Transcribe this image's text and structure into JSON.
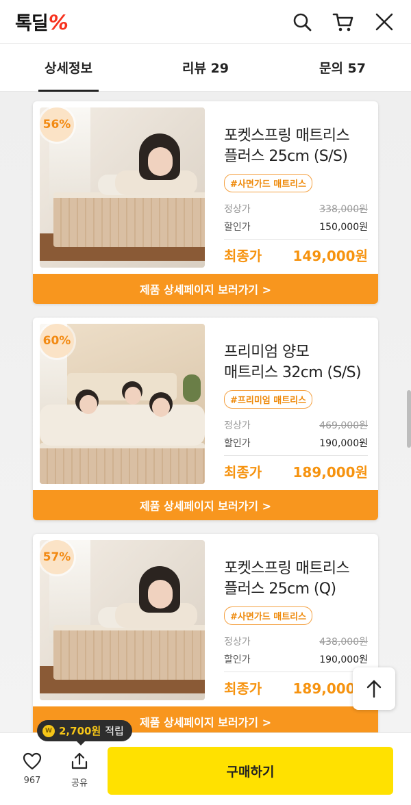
{
  "header": {
    "logo_text": "톡딜",
    "logo_mark": "%",
    "icons": [
      "search-icon",
      "cart-icon",
      "close-icon"
    ]
  },
  "tabs": [
    {
      "label": "상세정보",
      "active": true
    },
    {
      "label": "리뷰 29",
      "active": false
    },
    {
      "label": "문의 57",
      "active": false
    }
  ],
  "products": [
    {
      "badge": "56%",
      "title": "포켓스프링 매트리스\n플러스 25cm (S/S)",
      "tag": "#사면가드 매트리스",
      "normal_label": "정상가",
      "normal_price": "338,000원",
      "sale_label": "할인가",
      "sale_price": "150,000원",
      "final_label": "최종가",
      "final_price": "149,000원",
      "cta": "제품 상세페이지 보러가기  >"
    },
    {
      "badge": "60%",
      "title": "프리미엄 양모\n매트리스 32cm (S/S)",
      "tag": "#프리미엄 매트리스",
      "normal_label": "정상가",
      "normal_price": "469,000원",
      "sale_label": "할인가",
      "sale_price": "190,000원",
      "final_label": "최종가",
      "final_price": "189,000원",
      "cta": "제품 상세페이지 보러가기  >"
    },
    {
      "badge": "57%",
      "title": "포켓스프링 매트리스\n플러스 25cm (Q)",
      "tag": "#사면가드 매트리스",
      "normal_label": "정상가",
      "normal_price": "438,000원",
      "sale_label": "할인가",
      "sale_price": "190,000원",
      "final_label": "최종가",
      "final_price": "189,000원",
      "cta": "제품 상세페이지 보러가기  >"
    }
  ],
  "reward": {
    "coin": "W",
    "amount": "2,700원",
    "suffix": "적립"
  },
  "bottom_bar": {
    "like_count": "967",
    "share_label": "공유",
    "buy_label": "구매하기"
  },
  "colors": {
    "accent_orange": "#f8961e",
    "buy_yellow": "#ffe100",
    "logo_red": "#f7321e"
  }
}
